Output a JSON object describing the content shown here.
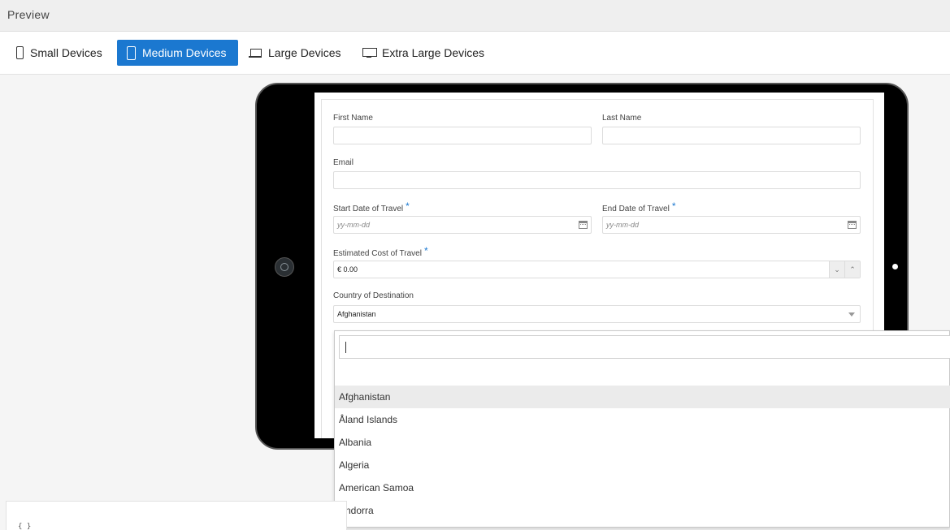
{
  "header": {
    "title": "Preview"
  },
  "devices": [
    {
      "label": "Small Devices",
      "icon": "phone-icon",
      "active": false
    },
    {
      "label": "Medium Devices",
      "icon": "tablet-icon",
      "active": true
    },
    {
      "label": "Large Devices",
      "icon": "laptop-icon",
      "active": false
    },
    {
      "label": "Extra Large Devices",
      "icon": "monitor-icon",
      "active": false
    }
  ],
  "form": {
    "first_name_label": "First Name",
    "last_name_label": "Last Name",
    "email_label": "Email",
    "start_date_label": "Start Date of Travel",
    "end_date_label": "End Date of Travel",
    "date_placeholder": "yy-mm-dd",
    "required_mark": "*",
    "cost_label": "Estimated Cost of Travel",
    "cost_value": "€ 0.00",
    "country_label": "Country of Destination",
    "country_value": "Afghanistan"
  },
  "dropdown": {
    "search_value": "",
    "options": [
      "Afghanistan",
      "Åland Islands",
      "Albania",
      "Algeria",
      "American Samoa",
      "Andorra"
    ],
    "highlighted": "Afghanistan"
  },
  "code_panel": {
    "text": "{ }"
  },
  "colors": {
    "accent": "#1b78d0",
    "device_frame": "#000000"
  }
}
